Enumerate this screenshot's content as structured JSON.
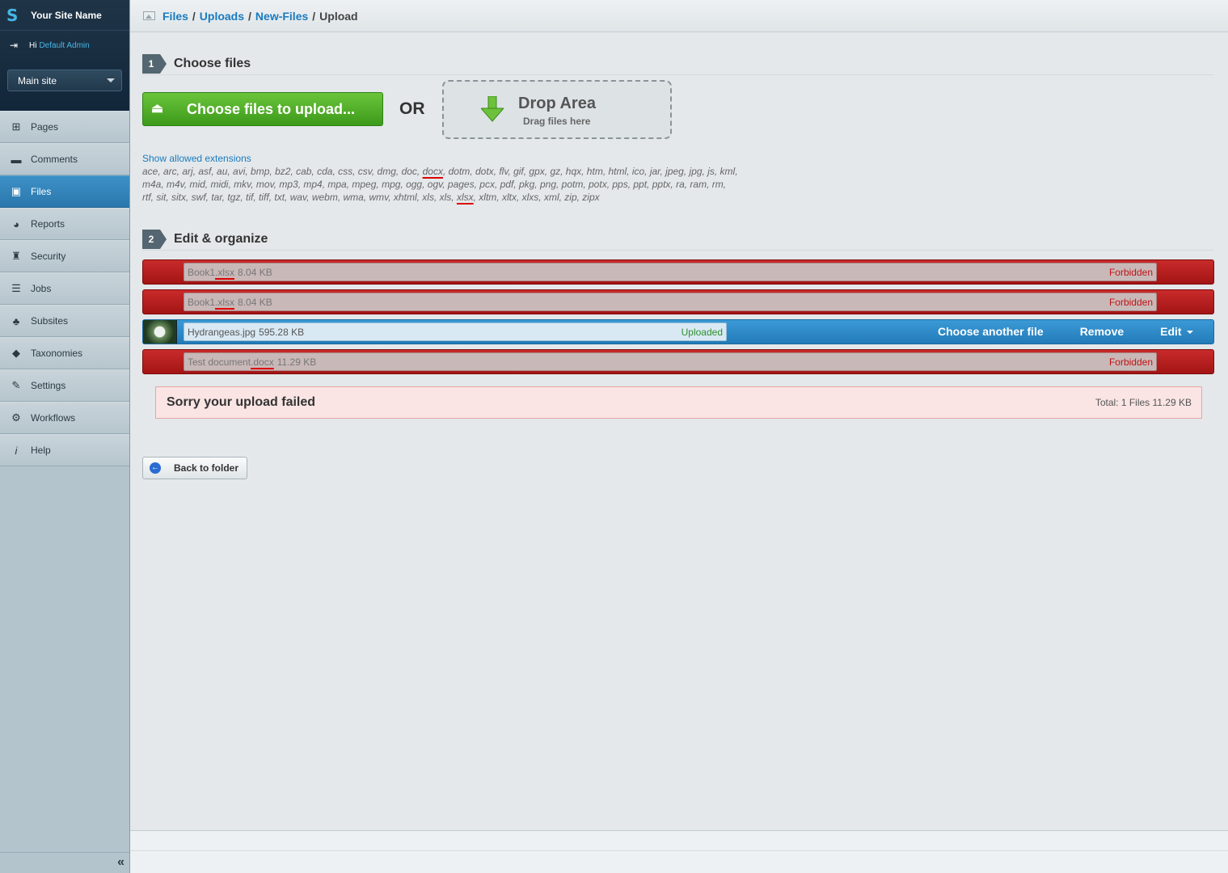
{
  "sidebar": {
    "site_name": "Your Site Name",
    "greeting": "Hi",
    "user": "Default Admin",
    "site_select": "Main site",
    "items": [
      {
        "label": "Pages",
        "icon": "sitemap-icon"
      },
      {
        "label": "Comments",
        "icon": "comment-icon"
      },
      {
        "label": "Files",
        "icon": "image-icon",
        "active": true
      },
      {
        "label": "Reports",
        "icon": "pie-chart-icon"
      },
      {
        "label": "Security",
        "icon": "users-icon"
      },
      {
        "label": "Jobs",
        "icon": "clipboard-icon"
      },
      {
        "label": "Subsites",
        "icon": "hierarchy-icon"
      },
      {
        "label": "Taxonomies",
        "icon": "tag-icon"
      },
      {
        "label": "Settings",
        "icon": "wrench-icon"
      },
      {
        "label": "Workflows",
        "icon": "workflow-icon"
      },
      {
        "label": "Help",
        "icon": "info-icon"
      }
    ],
    "collapse": "«"
  },
  "breadcrumbs": {
    "items": [
      "Files",
      "Uploads",
      "New-Files"
    ],
    "separator": "/",
    "current": "Upload"
  },
  "step1": {
    "number": "1",
    "title": "Choose files"
  },
  "upload": {
    "choose_label": "Choose files to upload...",
    "or": "OR",
    "drop_title": "Drop Area",
    "drop_sub": "Drag files here"
  },
  "extensions": {
    "link": "Show allowed extensions",
    "line1_a": "ace, arc, arj, asf, au, avi, bmp, bz2, cab, cda, css, csv, dmg, doc, ",
    "line1_u": "docx",
    "line1_b": ", dotm, dotx, flv, gif, gpx, gz, hqx, htm, html, ico, jar, jpeg, jpg, js, kml,",
    "line2": "m4a, m4v, mid, midi, mkv, mov, mp3, mp4, mpa, mpeg, mpg, ogg, ogv, pages, pcx, pdf, pkg, png, potm, potx, pps, ppt, pptx, ra, ram, rm,",
    "line3_a": "rtf, sit, sitx, swf, tar, tgz, tif, tiff, txt, wav, webm, wma, wmv, xhtml, xls, xls, ",
    "line3_u": "xlsx",
    "line3_b": ", xltm, xltx, xlxs, xml, zip, zipx"
  },
  "step2": {
    "number": "2",
    "title": "Edit & organize"
  },
  "files": [
    {
      "name_a": "Book1",
      "name_u": ".xlsx",
      "size": "8.04 KB",
      "status": "Forbidden"
    },
    {
      "name_a": "Book1",
      "name_u": ".xlsx",
      "size": "8.04 KB",
      "status": "Forbidden"
    },
    {
      "name": "Hydrangeas.jpg",
      "size": "595.28 KB",
      "status": "Uploaded",
      "actions": {
        "choose": "Choose another file",
        "remove": "Remove",
        "edit": "Edit"
      }
    },
    {
      "name_a": "Test document",
      "name_u": ".docx",
      "size": "11.29 KB",
      "status": "Forbidden"
    }
  ],
  "result": {
    "message": "Sorry your upload failed",
    "total": "Total: 1 Files 11.29 KB"
  },
  "back_button": "Back to folder",
  "colors": {
    "accent": "#2a78ad",
    "success": "#3c9a1b",
    "danger": "#b01a1a"
  }
}
